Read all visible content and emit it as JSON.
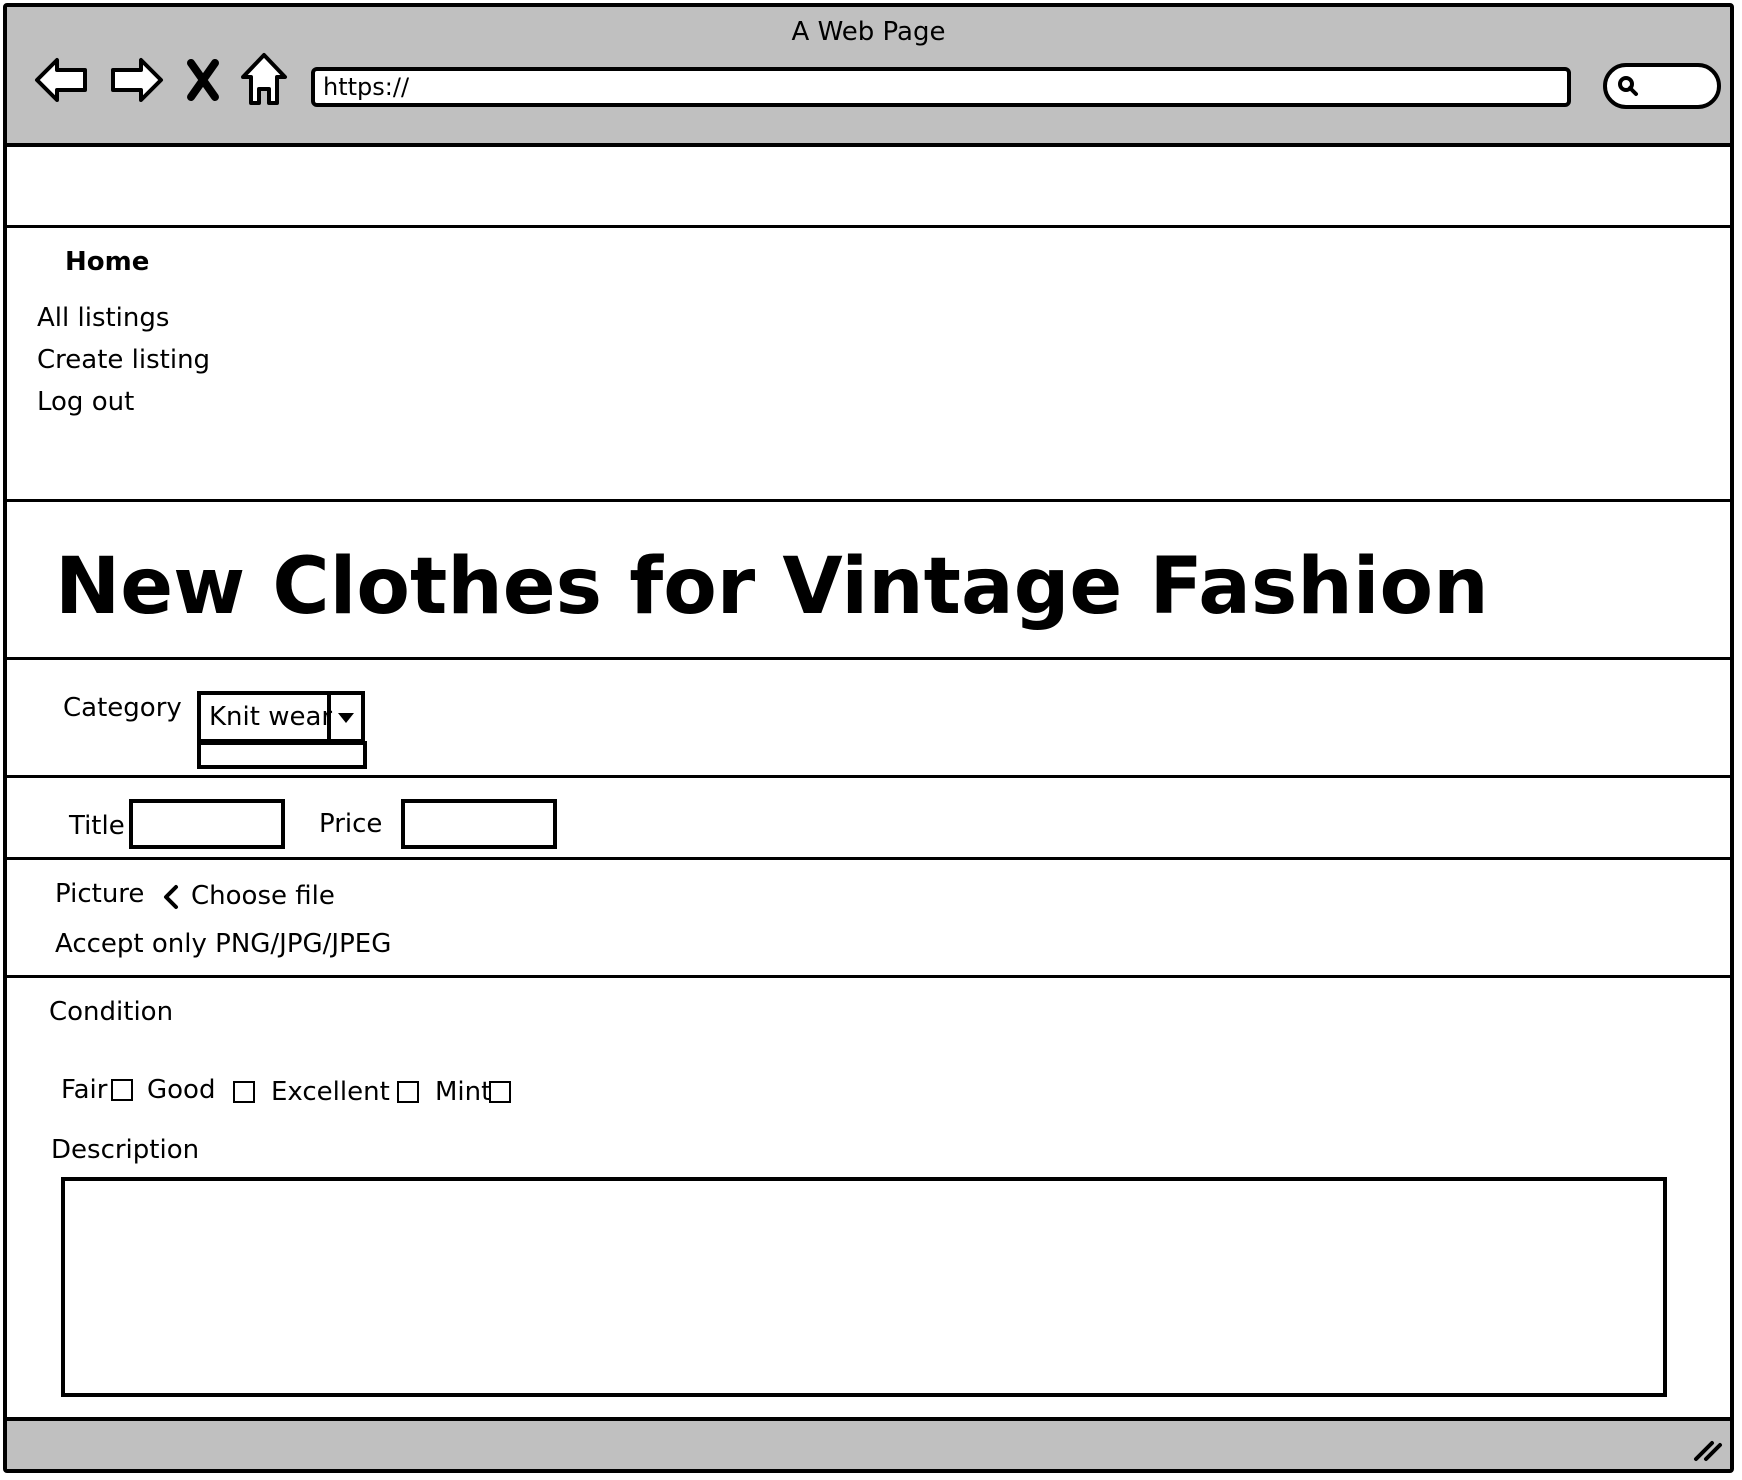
{
  "browser": {
    "window_title": "A Web Page",
    "url": "https://"
  },
  "nav": {
    "home": "Home",
    "links": [
      "All listings",
      "Create listing",
      "Log out"
    ]
  },
  "page": {
    "heading": "New Clothes for Vintage Fashion"
  },
  "form": {
    "category_label": "Category",
    "category_value": "Knit wear",
    "title_label": "Title",
    "price_label": "Price",
    "picture_label": "Picture",
    "choose_file": "Choose file",
    "accept_note": "Accept only PNG/JPG/JPEG",
    "condition_label": "Condition",
    "conditions": [
      "Fair",
      "Good",
      "Excellent",
      "Mint"
    ],
    "description_label": "Description"
  },
  "icons": [
    "back-icon",
    "forward-icon",
    "stop-icon",
    "home-icon",
    "search-icon",
    "chevron-left-icon",
    "dropdown-arrow-icon",
    "resize-grip-icon"
  ]
}
